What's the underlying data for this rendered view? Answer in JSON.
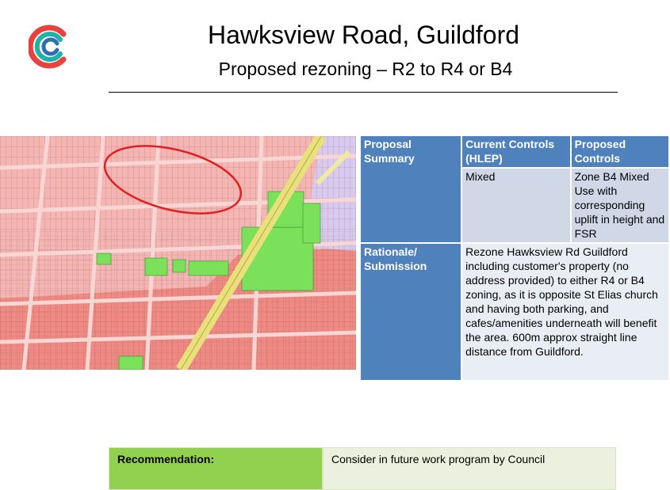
{
  "header": {
    "title": "Hawksview Road, Guildford",
    "subtitle": "Proposed rezoning – R2 to R4 or B4"
  },
  "colors": {
    "logo_red": "#e8423f",
    "logo_teal": "#1fb3a8",
    "logo_blue": "#2f6db5",
    "table_header": "#4f81bd",
    "table_cell_dark": "#d0d8e8",
    "table_cell_light": "#e9edf4",
    "map_residential": "#f4b5b3",
    "map_business": "#f08a82",
    "map_green": "#7be05a",
    "map_purple": "#d9c9ee",
    "map_road": "#e8e07a",
    "map_highlight": "#e02020",
    "rec_label": "#92d050",
    "rec_value": "#ebf1de"
  },
  "summary_table": {
    "proposal_label": "Proposal Summary",
    "current_controls_header": "Current Controls (HLEP)",
    "proposed_controls_header": "Proposed Controls",
    "current_value": "Mixed",
    "proposed_value": "Zone B4 Mixed Use with corresponding uplift in height and FSR",
    "rationale_label": "Rationale/ Submission",
    "rationale_text": "Rezone Hawksview Rd Guildford including customer's property (no address provided) to either R4 or B4 zoning, as it is opposite St Elias church and having both parking, and cafes/amenities underneath will benefit the area. 600m approx straight line distance from Guildford."
  },
  "recommendation": {
    "label": "Recommendation:",
    "value": "Consider in future work program by Council"
  }
}
